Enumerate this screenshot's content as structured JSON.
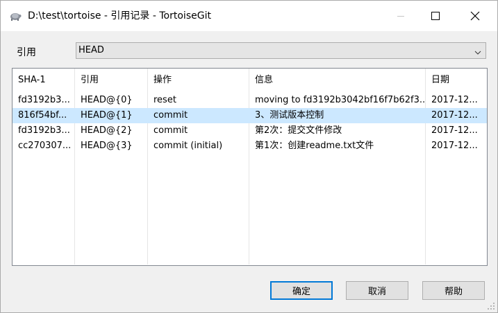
{
  "window": {
    "title": "D:\\test\\tortoise - 引用记录 - TortoiseGit",
    "app_icon": "tortoise-icon"
  },
  "ref_selector": {
    "label": "引用",
    "value": "HEAD"
  },
  "reflog_table": {
    "columns": [
      "SHA-1",
      "引用",
      "操作",
      "信息",
      "日期"
    ],
    "rows": [
      {
        "sha": "fd3192b3...",
        "ref": "HEAD@{0}",
        "action": "reset",
        "message": "moving to fd3192b3042bf16f7b62f3...",
        "date": "2017-12..."
      },
      {
        "sha": "816f54bf...",
        "ref": "HEAD@{1}",
        "action": "commit",
        "message": "3、测试版本控制",
        "date": "2017-12..."
      },
      {
        "sha": "fd3192b3...",
        "ref": "HEAD@{2}",
        "action": "commit",
        "message": "第2次：提交文件修改",
        "date": "2017-12..."
      },
      {
        "sha": "cc270307...",
        "ref": "HEAD@{3}",
        "action": "commit (initial)",
        "message": "第1次：创建readme.txt文件",
        "date": "2017-12..."
      }
    ],
    "selected_row": 1,
    "selection_color": "#cce8ff"
  },
  "buttons": {
    "ok": "确定",
    "cancel": "取消",
    "help": "帮助"
  },
  "colors": {
    "accent": "#0078d7"
  }
}
